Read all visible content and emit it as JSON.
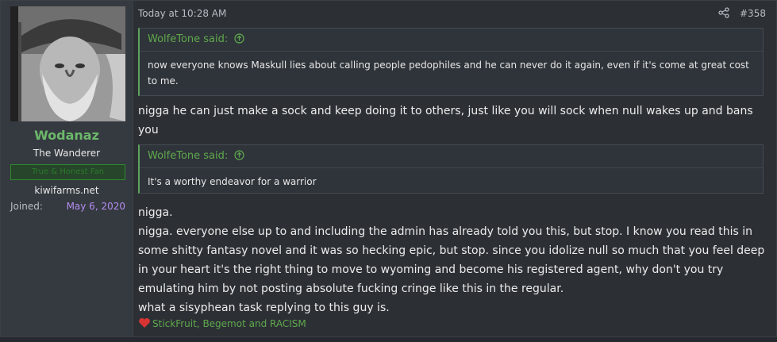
{
  "user": {
    "name": "Wodanaz",
    "title": "The Wanderer",
    "banner": "True & Honest Fan",
    "site": "kiwifarms.net",
    "joined_label": "Joined:",
    "joined_value": "May 6, 2020"
  },
  "post": {
    "timestamp": "Today at 10:28 AM",
    "number": "#358",
    "quotes": [
      {
        "author": "WolfeTone said:",
        "text": "now everyone knows Maskull lies about calling people pedophiles and he can never do it again, even if it's come at great cost to me."
      },
      {
        "author": "WolfeTone said:",
        "text": "It's a worthy endeavor for a warrior"
      }
    ],
    "reply1": "nigga he can just make a sock and keep doing it to others, just like you will sock when null wakes up and bans you",
    "reply2_lines": [
      "nigga.",
      "nigga. everyone else up to and including the admin has already told you this, but stop. I know you read this in some shitty fantasy novel and it was so hecking epic, but stop. since you idolize null so much that you feel deep in your heart it's the right thing to move to wyoming and become his registered agent, why don't you try emulating him by not posting absolute fucking cringe like this in the regular.",
      "what a sisyphean task replying to this guy is."
    ],
    "reactions": "StickFruit, Begemot and RACISM"
  },
  "colors": {
    "accent_green": "#5fa84c",
    "username_green": "#6cb86b",
    "joined_purple": "#b58cf0",
    "heart_red": "#d93434"
  },
  "icons": [
    "share-icon",
    "quote-arrow-icon",
    "heart-icon"
  ]
}
